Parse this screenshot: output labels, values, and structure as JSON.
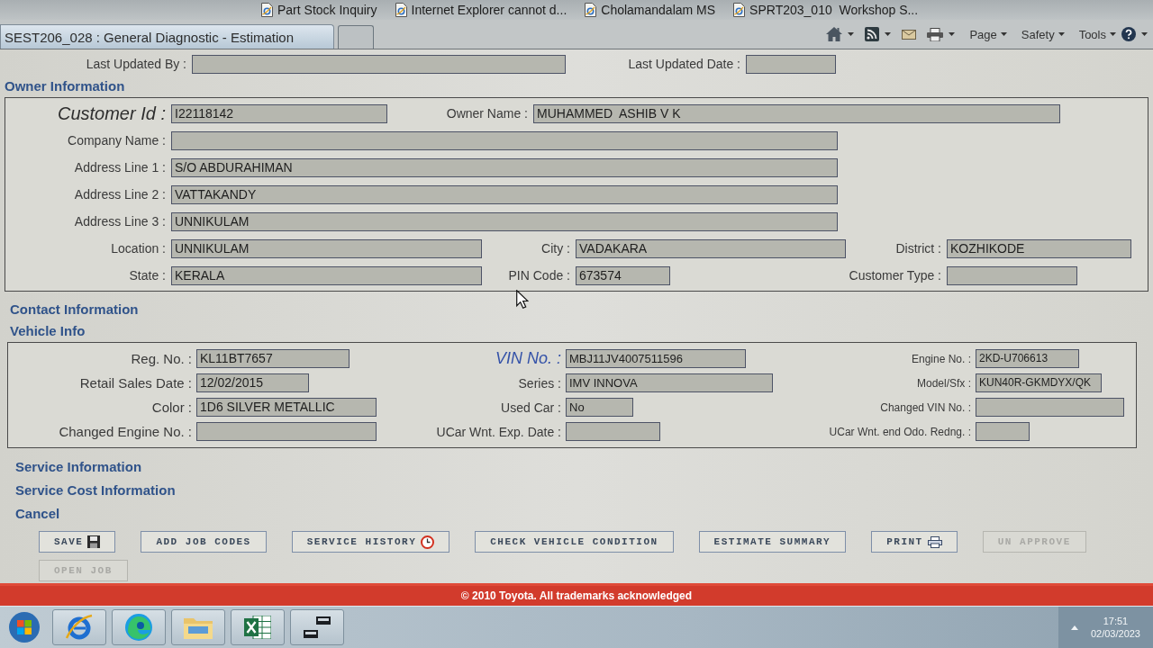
{
  "browser": {
    "favorites": [
      {
        "label": "Part Stock Inquiry"
      },
      {
        "label": "Internet Explorer cannot d..."
      },
      {
        "label": "Cholamandalam MS"
      },
      {
        "label": "SPRT203_010  Workshop S..."
      }
    ],
    "tabs": [
      {
        "label": "SEST206_028 : General Diagnostic - Estimation",
        "selected": true
      }
    ],
    "command_bar": {
      "menus": [
        "Page",
        "Safety",
        "Tools"
      ]
    }
  },
  "last_updated": {
    "fields": [
      {
        "label": "Last Updated By :"
      },
      {
        "label": "Last Updated Date :"
      }
    ]
  },
  "owner_information": {
    "title": "Owner Information",
    "rows": [
      [
        {
          "label": "Customer Id :",
          "value": "I22118142"
        },
        {
          "label": "Owner Name :",
          "value": "MUHAMMED  ASHIB V K"
        }
      ],
      [
        {
          "label": "Company Name :"
        }
      ],
      [
        {
          "label": "Address Line 1 :",
          "value": "S/O ABDURAHIMAN"
        }
      ],
      [
        {
          "label": "Address Line 2 :",
          "value": "VATTAKANDY"
        }
      ],
      [
        {
          "label": "Address Line 3 :",
          "value": "UNNIKULAM"
        }
      ],
      [
        {
          "label": "Location :",
          "value": "UNNIKULAM"
        },
        {
          "label": "City :",
          "value": "VADAKARA"
        },
        {
          "label": "District :",
          "value": "KOZHIKODE"
        }
      ],
      [
        {
          "label": "State :",
          "value": "KERALA"
        },
        {
          "label": "PIN Code :",
          "value": "673574"
        },
        {
          "label": "Customer Type :"
        }
      ]
    ]
  },
  "contact_information": {
    "title": "Contact Information"
  },
  "vehicle_info": {
    "title": "Vehicle Info",
    "rows": [
      [
        {
          "label": "Reg. No. :",
          "value": "KL11BT7657"
        },
        {
          "label": "VIN No. :",
          "value": "MBJ11JV4007511596"
        },
        {
          "label": "Engine No. :",
          "value": "2KD-U706613"
        }
      ],
      [
        {
          "label": "Retail Sales Date :",
          "value": "12/02/2015"
        },
        {
          "label": "Series :",
          "value": "IMV INNOVA"
        },
        {
          "label": "Model/Sfx :",
          "value": "KUN40R-GKMDYX/QK"
        }
      ],
      [
        {
          "label": "Color :",
          "value": "1D6 SILVER METALLIC"
        },
        {
          "label": "Used Car :",
          "value": "No"
        },
        {
          "label": "Changed VIN No. :"
        }
      ],
      [
        {
          "label": "Changed Engine No. :"
        },
        {
          "label": "UCar Wnt. Exp. Date :"
        },
        {
          "label": "UCar Wnt. end Odo. Redng. :"
        }
      ]
    ]
  },
  "links": [
    "Service Information",
    "Service Cost Information",
    "Cancel"
  ],
  "buttons": [
    {
      "label": "SAVE",
      "disabled": false
    },
    {
      "label": "ADD JOB CODES",
      "disabled": false
    },
    {
      "label": "SERVICE HISTORY",
      "disabled": false
    },
    {
      "label": "CHECK VEHICLE CONDITION",
      "disabled": false
    },
    {
      "label": "ESTIMATE SUMMARY",
      "disabled": false
    },
    {
      "label": "PRINT",
      "disabled": false
    },
    {
      "label": "UN APPROVE",
      "disabled": true
    },
    {
      "label": "OPEN JOB",
      "disabled": true
    }
  ],
  "footer": {
    "copyright": "© 2010 Toyota. All trademarks acknowledged"
  },
  "taskbar": {
    "time": "17:51",
    "date": "02/03/2023"
  }
}
